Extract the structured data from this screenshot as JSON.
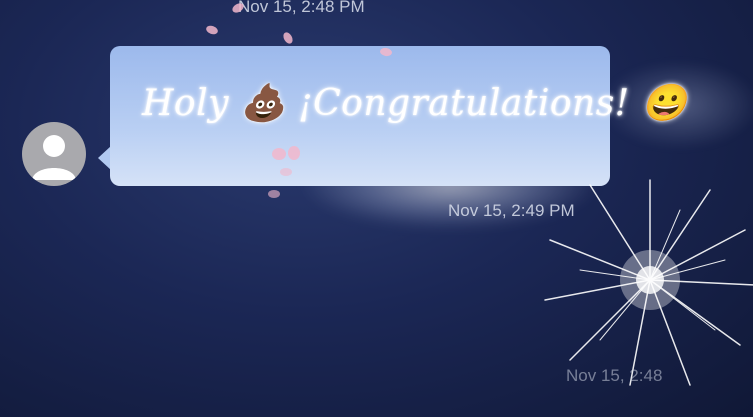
{
  "timestamps": {
    "top": "Nov 15, 2:48 PM",
    "middle": "Nov 15, 2:49 PM",
    "bottom": "Nov 15, 2:48"
  },
  "message": {
    "text": "Holy 💩 ¡Congratulations! 😀",
    "sender_avatar": "person-placeholder-icon",
    "effect": "fireworks"
  },
  "colors": {
    "background": "#1b2755",
    "bubble": "#b9cff3",
    "avatar": "#a9a9ad"
  }
}
